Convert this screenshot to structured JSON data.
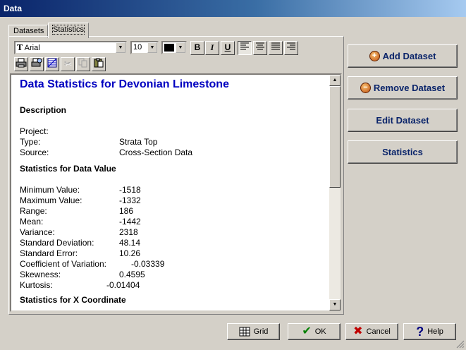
{
  "window": {
    "title": "Data"
  },
  "tabs": [
    {
      "label": "Datasets"
    },
    {
      "label": "Statistics"
    }
  ],
  "toolbar": {
    "font": "Arial",
    "size": "10",
    "color": "#000000",
    "bold": "B",
    "italic": "I",
    "underline": "U"
  },
  "document": {
    "title": "Data Statistics for Devonian Limestone",
    "description_heading": "Description",
    "description": [
      {
        "label": "Project:",
        "value": ""
      },
      {
        "label": "Type:",
        "value": "Strata Top"
      },
      {
        "label": "Source:",
        "value": "Cross-Section Data"
      }
    ],
    "stats_heading": "Statistics for Data Value",
    "stats": [
      {
        "label": "Minimum Value:",
        "value": "-1518"
      },
      {
        "label": "Maximum Value:",
        "value": "-1332"
      },
      {
        "label": "Range:",
        "value": "186"
      },
      {
        "label": "Mean:",
        "value": "-1442"
      },
      {
        "label": "Variance:",
        "value": "2318"
      },
      {
        "label": "Standard Deviation:",
        "value": "48.14"
      },
      {
        "label": "Standard Error:",
        "value": "10.26"
      },
      {
        "label": "Coefficient of Variation:",
        "value": "-0.03339"
      },
      {
        "label": "Skewness:",
        "value": "0.4595"
      },
      {
        "label": "Kurtosis:",
        "value": "-0.01404"
      }
    ],
    "next_heading": "Statistics for X Coordinate"
  },
  "side_buttons": {
    "add": "Add Dataset",
    "remove": "Remove Dataset",
    "edit": "Edit Dataset",
    "statistics": "Statistics"
  },
  "bottom_buttons": {
    "grid": "Grid",
    "ok": "OK",
    "cancel": "Cancel",
    "help": "Help"
  }
}
